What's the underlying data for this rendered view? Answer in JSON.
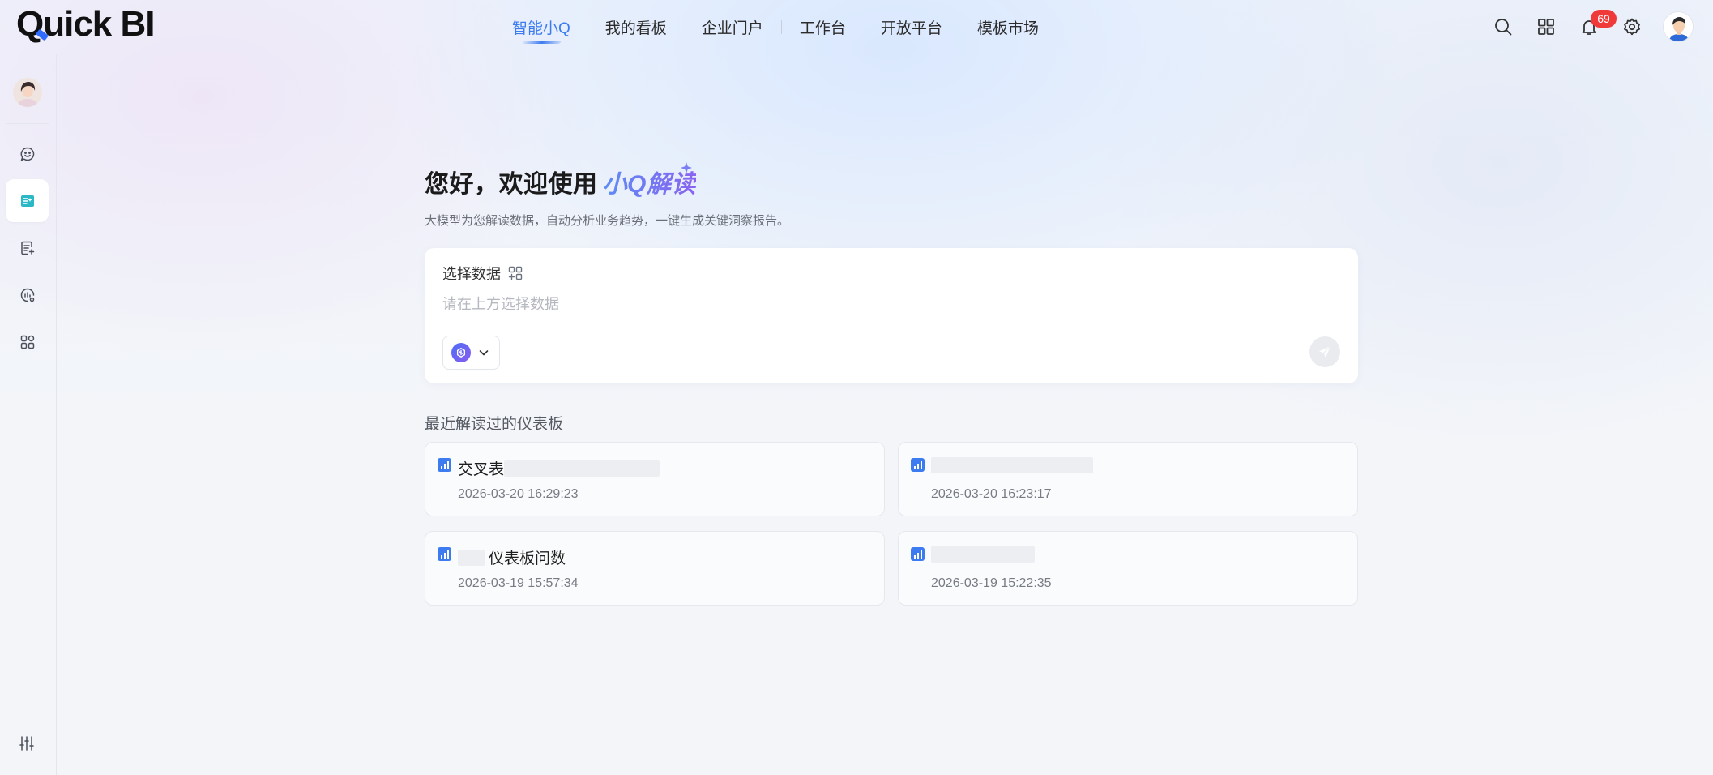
{
  "app": {
    "logo_text": "Quick BI"
  },
  "nav": {
    "items": [
      {
        "label": "智能小Q",
        "active": true
      },
      {
        "label": "我的看板",
        "active": false
      },
      {
        "label": "企业门户",
        "active": false
      },
      {
        "label": "工作台",
        "active": false
      },
      {
        "label": "开放平台",
        "active": false
      },
      {
        "label": "模板市场",
        "active": false
      }
    ]
  },
  "top_actions": {
    "icons": [
      "search-icon",
      "apps-grid-icon",
      "bell-icon",
      "gear-icon",
      "user-avatar"
    ],
    "notification_count": "69"
  },
  "sidebar": {
    "items": [
      {
        "icon": "chat-icon",
        "active": false
      },
      {
        "icon": "insight-report-icon",
        "active": true
      },
      {
        "icon": "document-add-icon",
        "active": false
      },
      {
        "icon": "data-gear-icon",
        "active": false
      },
      {
        "icon": "app-grid-icon",
        "active": false
      }
    ],
    "bottom_icon": "sliders-icon"
  },
  "hero": {
    "title_prefix": "您好，欢迎使用",
    "title_brand": "小Q解读",
    "subtitle": "大模型为您解读数据，自动分析业务趋势，一键生成关键洞察报告。"
  },
  "input_card": {
    "select_label": "选择数据",
    "placeholder": "请在上方选择数据"
  },
  "recent": {
    "title": "最近解读过的仪表板",
    "items": [
      {
        "name": "交叉表",
        "time": "2026-03-20 16:29:23"
      },
      {
        "name": "",
        "time": "2026-03-20 16:23:17"
      },
      {
        "name": "仪表板问数",
        "time": "2026-03-19 15:57:34"
      },
      {
        "name": "",
        "time": "2026-03-19 15:22:35"
      }
    ]
  },
  "colors": {
    "accent": "#3d7cf0",
    "badge": "#f03a3a",
    "brand_gradient_start": "#5d8cf5",
    "brand_gradient_end": "#8a63f0"
  }
}
